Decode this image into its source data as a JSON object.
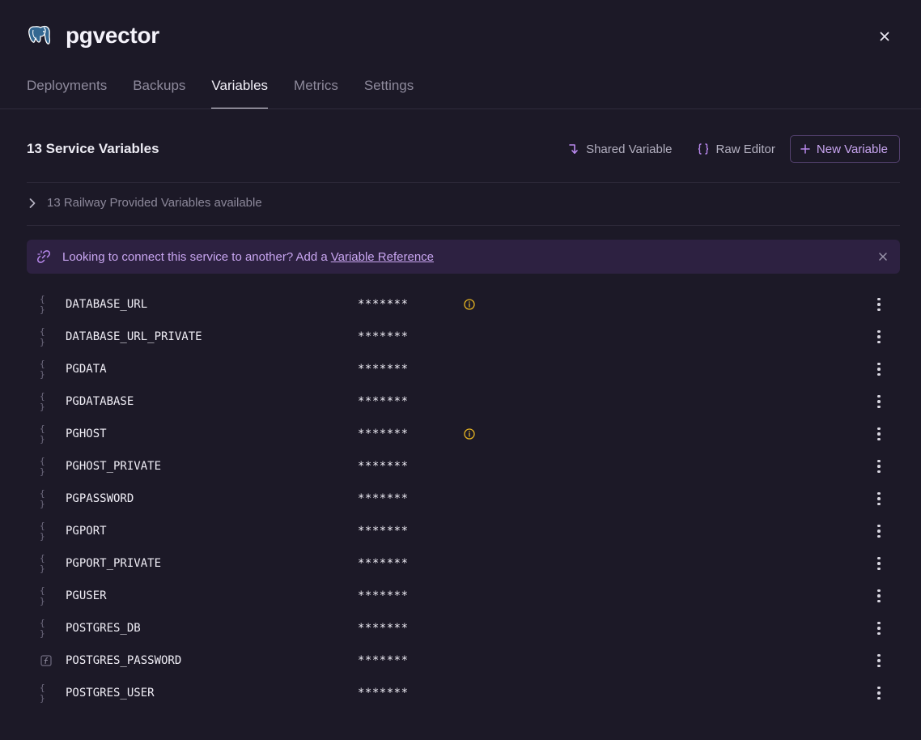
{
  "service": {
    "name": "pgvector",
    "icon": "postgres-elephant-logo"
  },
  "tabs": [
    {
      "label": "Deployments",
      "active": false
    },
    {
      "label": "Backups",
      "active": false
    },
    {
      "label": "Variables",
      "active": true
    },
    {
      "label": "Metrics",
      "active": false
    },
    {
      "label": "Settings",
      "active": false
    }
  ],
  "toolbar": {
    "title": "13 Service Variables",
    "shared_variable_label": "Shared Variable",
    "raw_editor_label": "Raw Editor",
    "new_variable_label": "New Variable"
  },
  "provided": {
    "label": "13 Railway Provided Variables available"
  },
  "banner": {
    "text": "Looking to connect this service to another? Add a",
    "link_text": "Variable Reference"
  },
  "colors": {
    "accent": "#c8a5f0",
    "warning": "#e6b422",
    "background": "#1c1927"
  },
  "variables": [
    {
      "name": "DATABASE_URL",
      "value": "*******",
      "type": "reference",
      "warning": true
    },
    {
      "name": "DATABASE_URL_PRIVATE",
      "value": "*******",
      "type": "reference",
      "warning": false
    },
    {
      "name": "PGDATA",
      "value": "*******",
      "type": "reference",
      "warning": false
    },
    {
      "name": "PGDATABASE",
      "value": "*******",
      "type": "reference",
      "warning": false
    },
    {
      "name": "PGHOST",
      "value": "*******",
      "type": "reference",
      "warning": true
    },
    {
      "name": "PGHOST_PRIVATE",
      "value": "*******",
      "type": "reference",
      "warning": false
    },
    {
      "name": "PGPASSWORD",
      "value": "*******",
      "type": "reference",
      "warning": false
    },
    {
      "name": "PGPORT",
      "value": "*******",
      "type": "reference",
      "warning": false
    },
    {
      "name": "PGPORT_PRIVATE",
      "value": "*******",
      "type": "reference",
      "warning": false
    },
    {
      "name": "PGUSER",
      "value": "*******",
      "type": "reference",
      "warning": false
    },
    {
      "name": "POSTGRES_DB",
      "value": "*******",
      "type": "reference",
      "warning": false
    },
    {
      "name": "POSTGRES_PASSWORD",
      "value": "*******",
      "type": "function",
      "warning": false
    },
    {
      "name": "POSTGRES_USER",
      "value": "*******",
      "type": "reference",
      "warning": false
    }
  ]
}
